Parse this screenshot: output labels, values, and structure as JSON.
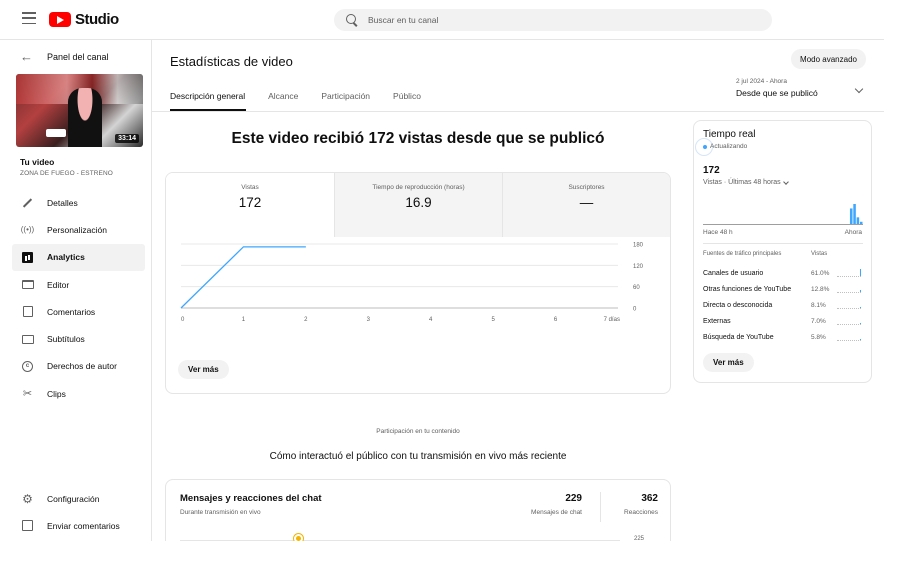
{
  "header": {
    "brand": "Studio",
    "search_placeholder": "Buscar en tu canal"
  },
  "sidebar": {
    "back_label": "Panel del canal",
    "video": {
      "duration": "33:14",
      "title": "Tu video",
      "subtitle": "ZONA DE FUEGO - ESTRENO"
    },
    "items": [
      {
        "label": "Detalles",
        "icon": "pencil-icon"
      },
      {
        "label": "Personalización",
        "icon": "broadcast-icon"
      },
      {
        "label": "Analytics",
        "icon": "analytics-icon",
        "active": true
      },
      {
        "label": "Editor",
        "icon": "editor-icon"
      },
      {
        "label": "Comentarios",
        "icon": "comments-icon"
      },
      {
        "label": "Subtítulos",
        "icon": "subtitles-icon"
      },
      {
        "label": "Derechos de autor",
        "icon": "copyright-icon"
      },
      {
        "label": "Clips",
        "icon": "clips-icon"
      }
    ],
    "bottom_items": [
      {
        "label": "Configuración",
        "icon": "gear-icon"
      },
      {
        "label": "Enviar comentarios",
        "icon": "feedback-icon"
      }
    ]
  },
  "main": {
    "title": "Estadísticas de video",
    "advanced_button": "Modo avanzado",
    "date_range": {
      "small": "2 jul 2024 - Ahora",
      "label": "Desde que se publicó"
    },
    "tabs": [
      "Descripción general",
      "Alcance",
      "Participación",
      "Público"
    ],
    "headline": "Este video recibió 172 vistas desde que se publicó",
    "metrics": [
      {
        "label": "Vistas",
        "value": "172"
      },
      {
        "label": "Tiempo de reproducción (horas)",
        "value": "16.9"
      },
      {
        "label": "Suscriptores",
        "value": "—"
      }
    ],
    "see_more": "Ver más",
    "engagement_label": "Participación en tu contenido",
    "engagement_title": "Cómo interactuó el público con tu transmisión en vivo más reciente",
    "chat": {
      "title": "Mensajes y reacciones del chat",
      "subtitle": "Durante transmisión en vivo",
      "messages_value": "229",
      "messages_label": "Mensajes de chat",
      "reactions_value": "362",
      "reactions_label": "Reacciones",
      "axis_tick": "225"
    }
  },
  "chart_data": {
    "type": "line",
    "x": [
      0,
      1,
      2
    ],
    "series": [
      {
        "values": [
          0,
          172,
          172
        ]
      }
    ],
    "x_ticks": [
      "0",
      "1",
      "2",
      "3",
      "4",
      "5",
      "6",
      "7 días"
    ],
    "y_ticks": [
      "0",
      "60",
      "120",
      "180"
    ],
    "xlim": [
      0,
      7
    ],
    "ylim": [
      0,
      180
    ],
    "grid": true,
    "color": "#3ea6ff"
  },
  "realtime": {
    "title": "Tiempo real",
    "status": "Actualizando",
    "count": "172",
    "period": "Vistas · Últimas 48 horas",
    "axis_left": "Hace 48 h",
    "axis_right": "Ahora",
    "table_header_source": "Fuentes de tráfico principales",
    "table_header_views": "Vistas",
    "sources": [
      {
        "name": "Canales de usuario",
        "pct": "61.0%",
        "share": 0.61
      },
      {
        "name": "Otras funciones de YouTube",
        "pct": "12.8%",
        "share": 0.128
      },
      {
        "name": "Directa o desconocida",
        "pct": "8.1%",
        "share": 0.081
      },
      {
        "name": "Externas",
        "pct": "7.0%",
        "share": 0.07
      },
      {
        "name": "Búsqueda de YouTube",
        "pct": "5.8%",
        "share": 0.058
      }
    ],
    "spark": [
      0,
      0,
      0,
      0,
      0,
      0,
      0,
      0,
      0,
      0,
      0,
      0,
      0,
      0,
      0,
      0,
      0,
      0,
      0,
      0,
      0,
      0,
      0,
      0,
      0,
      0,
      0,
      0,
      0,
      0,
      0,
      0,
      0,
      0,
      0,
      0,
      0,
      0,
      0,
      0,
      0,
      0,
      0,
      0,
      14,
      18,
      6,
      2
    ],
    "see_more": "Ver más",
    "accent": "#3ea6ff"
  }
}
